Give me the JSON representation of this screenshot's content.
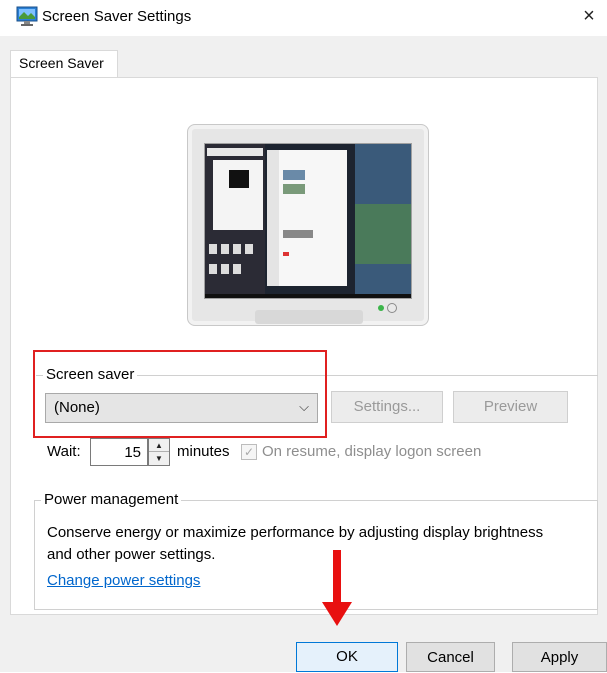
{
  "window": {
    "title": "Screen Saver Settings",
    "close_glyph": "×",
    "icon": "screen-saver-settings-icon"
  },
  "tabs": [
    {
      "label": "Screen Saver",
      "selected": true
    }
  ],
  "screen_saver": {
    "group_label": "Screen saver",
    "selected": "(None)",
    "dropdown_arrow": "⌵",
    "settings_button": "Settings...",
    "preview_button": "Preview",
    "wait_label": "Wait:",
    "wait_value": "15",
    "minutes_label": "minutes",
    "resume_checkbox_label": "On resume, display logon screen",
    "resume_checked": true,
    "resume_enabled": false
  },
  "power_management": {
    "group_label": "Power management",
    "description": "Conserve energy or maximize performance by adjusting display brightness and other power settings.",
    "link": "Change power settings"
  },
  "buttons": {
    "ok": "OK",
    "cancel": "Cancel",
    "apply": "Apply"
  },
  "colors": {
    "highlight": "#e02020",
    "arrow": "#e81010",
    "link": "#0066cc",
    "ok_border": "#0078d7"
  }
}
